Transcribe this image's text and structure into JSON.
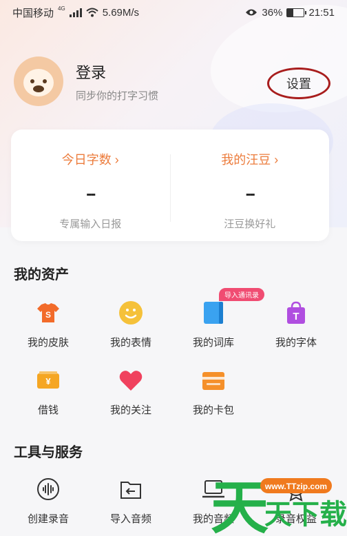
{
  "status_bar": {
    "carrier": "中国移动",
    "network": "4G",
    "speed": "5.69M/s",
    "battery": "36%",
    "battery_level": 0.36,
    "time": "21:51"
  },
  "profile": {
    "title": "登录",
    "subtitle": "同步你的打字习惯",
    "settings_label": "设置"
  },
  "stats": [
    {
      "title": "今日字数",
      "value": "--",
      "sub": "专属输入日报"
    },
    {
      "title": "我的汪豆",
      "value": "--",
      "sub": "汪豆换好礼"
    }
  ],
  "assets": {
    "title": "我的资产",
    "badge": "导入通讯录",
    "items": [
      {
        "label": "我的皮肤",
        "icon": "shirt-icon",
        "color": "#f26b2a"
      },
      {
        "label": "我的表情",
        "icon": "smiley-icon",
        "color": "#f5c13a"
      },
      {
        "label": "我的词库",
        "icon": "book-icon",
        "color": "#3aa2f0"
      },
      {
        "label": "我的字体",
        "icon": "font-bag-icon",
        "color": "#b04ee0"
      },
      {
        "label": "借钱",
        "icon": "money-icon",
        "color": "#f5a623"
      },
      {
        "label": "我的关注",
        "icon": "heart-icon",
        "color": "#f0415e"
      },
      {
        "label": "我的卡包",
        "icon": "card-icon",
        "color": "#f5902a"
      }
    ]
  },
  "tools": {
    "title": "工具与服务",
    "items": [
      {
        "label": "创建录音",
        "icon": "voice-record-icon"
      },
      {
        "label": "导入音频",
        "icon": "import-audio-icon"
      },
      {
        "label": "我的音频",
        "icon": "laptop-audio-icon"
      },
      {
        "label": "录音权益",
        "icon": "record-rights-icon"
      }
    ]
  },
  "watermark": {
    "logo_text": "天天下载",
    "url": "www.TTzip.com"
  }
}
